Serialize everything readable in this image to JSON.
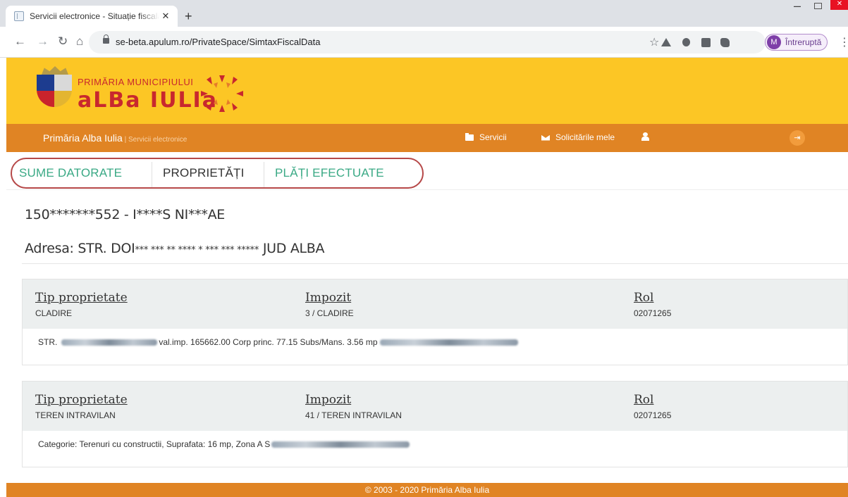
{
  "browser": {
    "tab_title": "Servicii electronice - Situație fiscală",
    "tab_close": "✕",
    "new_tab": "+",
    "url": "se-beta.apulum.ro/PrivateSpace/SimtaxFiscalData",
    "profile_initial": "M",
    "profile_status": "Întreruptă"
  },
  "header": {
    "brand_small": "PRIMĂRIA MUNICIPIULUI",
    "brand_big": "aLBa IULIa",
    "colors": {
      "banner": "#fcc625",
      "navbar": "#e08424",
      "accent_green": "#3aa985",
      "brand_red": "#c8282e"
    }
  },
  "navbar": {
    "title": "Primăria Alba Iulia",
    "subtitle": " | Servicii electronice",
    "items": [
      {
        "icon": "folder-icon",
        "label": "Servicii"
      },
      {
        "icon": "envelope-icon",
        "label": "Solicitările mele"
      },
      {
        "icon": "user-icon",
        "label": ""
      }
    ],
    "logout_icon": "logout-icon"
  },
  "tabs": [
    {
      "label": "SUME DATORATE"
    },
    {
      "label": "PROPRIETĂȚI"
    },
    {
      "label": "PLĂȚI EFECTUATE"
    }
  ],
  "taxpayer": {
    "id_name": "150*******552 - I****S NI***AE",
    "address_prefix": "Adresa: STR. DOI",
    "address_masked": "*** *** ** **** * *** *** *****",
    "address_suffix": " JUD ALBA"
  },
  "properties": [
    {
      "col1_header": "Tip proprietate",
      "col1_value": "CLADIRE",
      "col2_header": "Impozit",
      "col2_value": "3 / CLADIRE",
      "col3_header": "Rol",
      "col3_value": "02071265",
      "detail_prefix": "STR.",
      "detail_middle": "val.imp. 165662.00 Corp princ. 77.15 Subs/Mans. 3.56 mp"
    },
    {
      "col1_header": "Tip proprietate",
      "col1_value": "TEREN INTRAVILAN",
      "col2_header": "Impozit",
      "col2_value": "41 / TEREN INTRAVILAN",
      "col3_header": "Rol",
      "col3_value": "02071265",
      "detail_prefix": "Categorie: Terenuri cu constructii, Suprafata: 16 mp, Zona A S",
      "detail_middle": ""
    }
  ],
  "footer": {
    "text": "© 2003 - 2020 Primăria Alba Iulia"
  }
}
